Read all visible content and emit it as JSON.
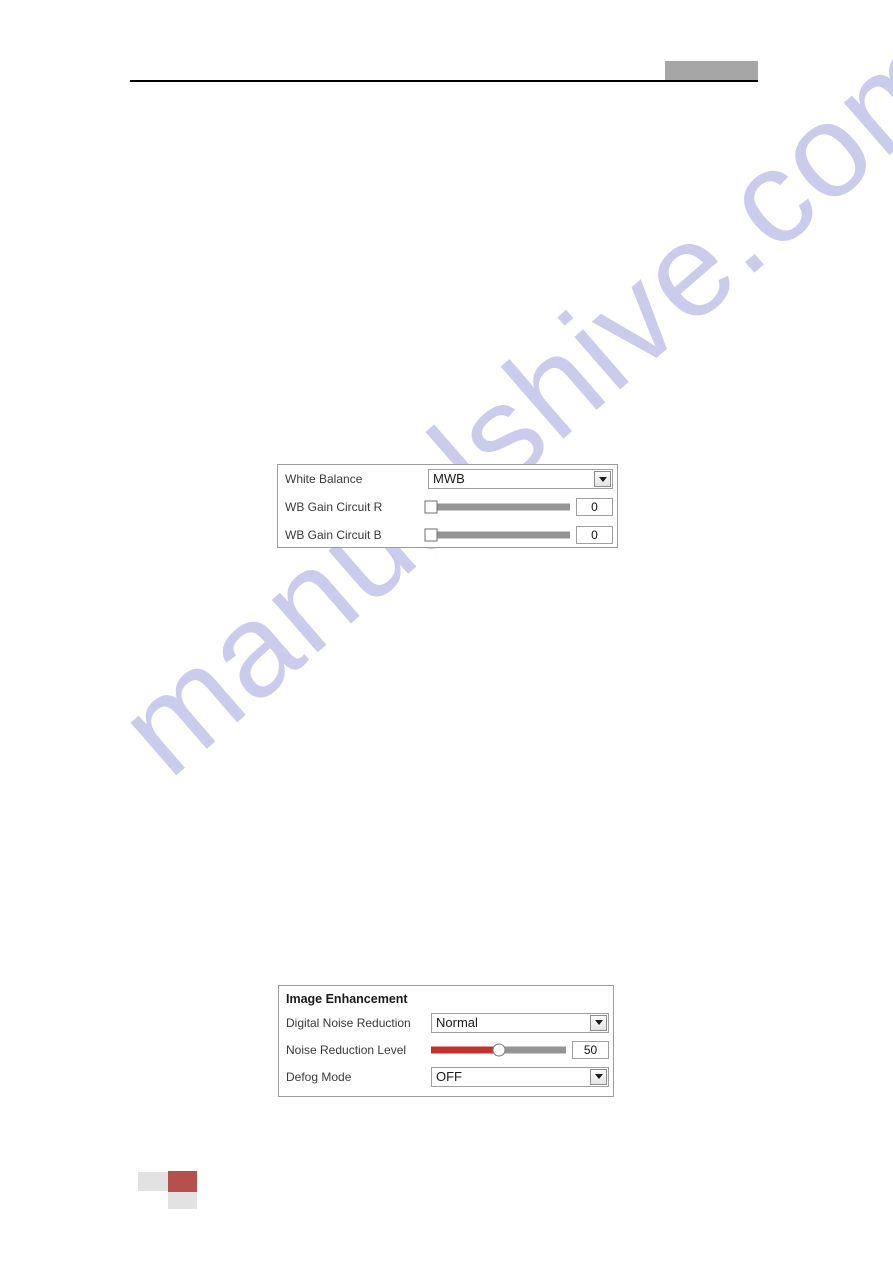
{
  "page": {
    "watermark": "manualshive.com",
    "watermark_color": "#c9c9ec",
    "background_color": "#ffffff"
  },
  "header": {
    "badge_label": "",
    "badge_color": "#a6a6a6",
    "rule_color": "#000000"
  },
  "panels": [
    {
      "id": "white-balance",
      "title": "",
      "rows": [
        {
          "type": "select",
          "label": "White Balance",
          "value": "MWB",
          "icon": "chevron-down-icon"
        },
        {
          "type": "slider",
          "label": "WB Gain Circuit R",
          "value": "0",
          "percent": 0,
          "fill_percent": 0,
          "handle": "square",
          "track_color": "#949494"
        },
        {
          "type": "slider",
          "label": "WB Gain Circuit B",
          "value": "0",
          "percent": 0,
          "fill_percent": 0,
          "handle": "square",
          "track_color": "#949494"
        }
      ]
    },
    {
      "id": "image-enhancement",
      "title": "Image Enhancement",
      "rows": [
        {
          "type": "select",
          "label": "Digital Noise Reduction",
          "value": "Normal",
          "icon": "chevron-down-icon"
        },
        {
          "type": "slider",
          "label": "Noise Reduction Level",
          "value": "50",
          "percent": 50,
          "fill_percent": 50,
          "handle": "round",
          "track_color": "#949494",
          "fill_color": "#c4322f"
        },
        {
          "type": "select",
          "label": "Defog Mode",
          "value": "OFF",
          "icon": "chevron-down-icon"
        }
      ]
    }
  ],
  "footer": {
    "mark_gray_color": "#e2e2e2",
    "mark_red_color": "#b5504c"
  }
}
